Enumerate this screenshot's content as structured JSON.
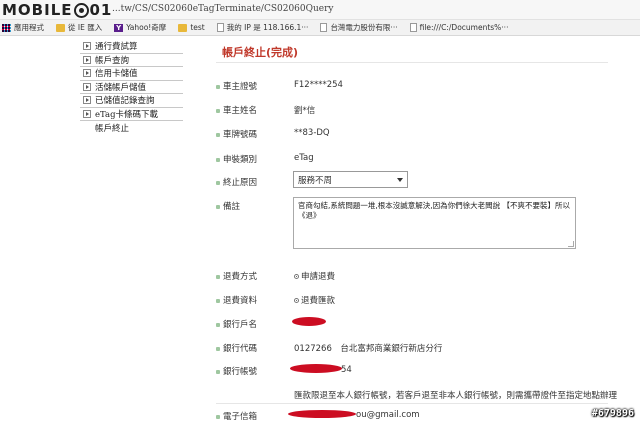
{
  "browser": {
    "logo_text_1": "MOBILE",
    "logo_text_2": "01",
    "url": "...tw/CS/CS02060eTagTerminate/CS02060Query",
    "bookmarks": [
      {
        "icon": "apps-icon",
        "label": "應用程式"
      },
      {
        "icon": "folder-icon",
        "label": "從 IE 匯入"
      },
      {
        "icon": "yahoo-icon",
        "label": "Yahoo!奇摩"
      },
      {
        "icon": "folder-icon",
        "label": "test"
      },
      {
        "icon": "page-icon",
        "label": "我的 IP 是 118.166.1···"
      },
      {
        "icon": "page-icon",
        "label": "台灣電力股份有限···"
      },
      {
        "icon": "page-icon",
        "label": "file:///C:/Documents%···"
      }
    ]
  },
  "sidebar": {
    "items": [
      {
        "label": "通行費試算"
      },
      {
        "label": "帳戶查詢"
      },
      {
        "label": "信用卡儲值"
      },
      {
        "label": "活儲帳戶儲值"
      },
      {
        "label": "已儲值記錄查詢"
      },
      {
        "label": "eTag卡條碼下載"
      }
    ],
    "current": "帳戶終止"
  },
  "main": {
    "title": "帳戶終止(完成)",
    "fields": {
      "owner_id_label": "車主證號",
      "owner_id_value": "F12****254",
      "owner_name_label": "車主姓名",
      "owner_name_value": "劉*信",
      "plate_label": "車牌號碼",
      "plate_value": "**83-DQ",
      "device_label": "申裝類別",
      "device_value": "eTag",
      "reason_label": "終止原因",
      "reason_value": "服務不周",
      "remark_label": "備註",
      "remark_value": "官商勾結,系統問題一堆,根本沒誠意解決,因為你們徐大老闆說 【不爽不要裝】所以《退》",
      "refund_method_label": "退費方式",
      "refund_method_value": "申請退費",
      "refund_data_label": "退費資料",
      "refund_data_value": "退費匯款",
      "bank_name_label": "銀行戶名",
      "bank_code_label": "銀行代碼",
      "bank_code_value": "0127266　台北富邦商業銀行新店分行",
      "bank_account_label": "銀行帳號",
      "bank_account_suffix": "54",
      "note": "匯款限退至本人銀行帳號，若客戶退至非本人銀行帳號，則需攜帶證件至指定地點辦理",
      "email_label": "電子信箱",
      "email_suffix": "ou@gmail.com"
    }
  },
  "watermark": "#679896",
  "colors": {
    "title": "#c0392b",
    "redaction": "#cc0d22",
    "bullet": "#9fc7a0"
  }
}
